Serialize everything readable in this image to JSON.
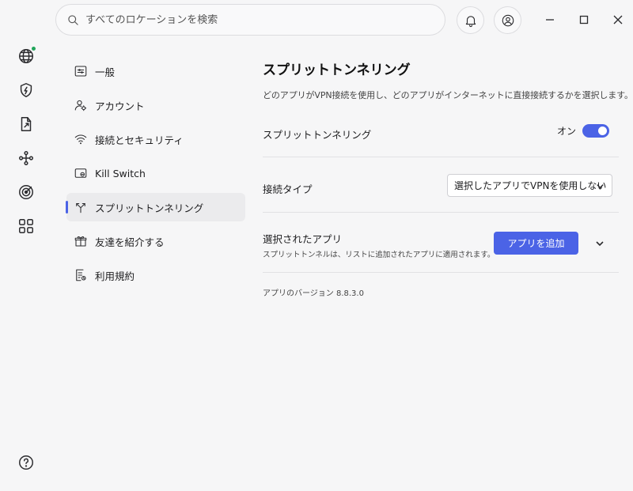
{
  "search": {
    "placeholder": "すべてのロケーションを検索"
  },
  "nav": {
    "items": [
      {
        "label": "一般"
      },
      {
        "label": "アカウント"
      },
      {
        "label": "接続とセキュリティ"
      },
      {
        "label": "Kill Switch"
      },
      {
        "label": "スプリットトンネリング"
      },
      {
        "label": "友達を紹介する"
      },
      {
        "label": "利用規約"
      }
    ]
  },
  "content": {
    "title": "スプリットトンネリング",
    "description": "どのアプリがVPN接続を使用し、どのアプリがインターネットに直接接続するかを選択します。",
    "split_tunneling": {
      "label": "スプリットトンネリング",
      "state": "オン"
    },
    "connection_type": {
      "label": "接続タイプ",
      "selected": "選択したアプリでVPNを使用しない"
    },
    "selected_apps": {
      "label": "選択されたアプリ",
      "sublabel": "スプリットトンネルは、リストに追加されたアプリに適用されます。",
      "add_button": "アプリを追加"
    },
    "version": "アプリのバージョン 8.8.3.0"
  },
  "colors": {
    "accent": "#4b63e6",
    "status_online": "#22a55b"
  }
}
